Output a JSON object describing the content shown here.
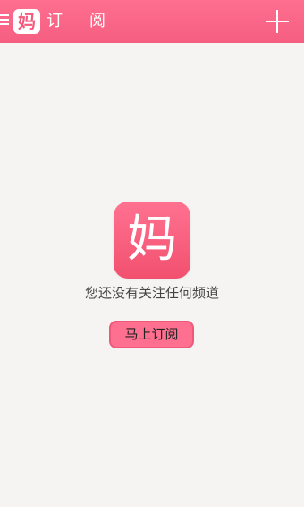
{
  "header": {
    "logo_char": "妈",
    "title": "订阅",
    "menu_icon": "hamburger-menu-icon",
    "add_icon": "plus-icon",
    "accent_color": "#f55e80"
  },
  "empty_state": {
    "logo_char": "妈",
    "message": "您还没有关注任何频道",
    "button_label": "马上订阅"
  }
}
